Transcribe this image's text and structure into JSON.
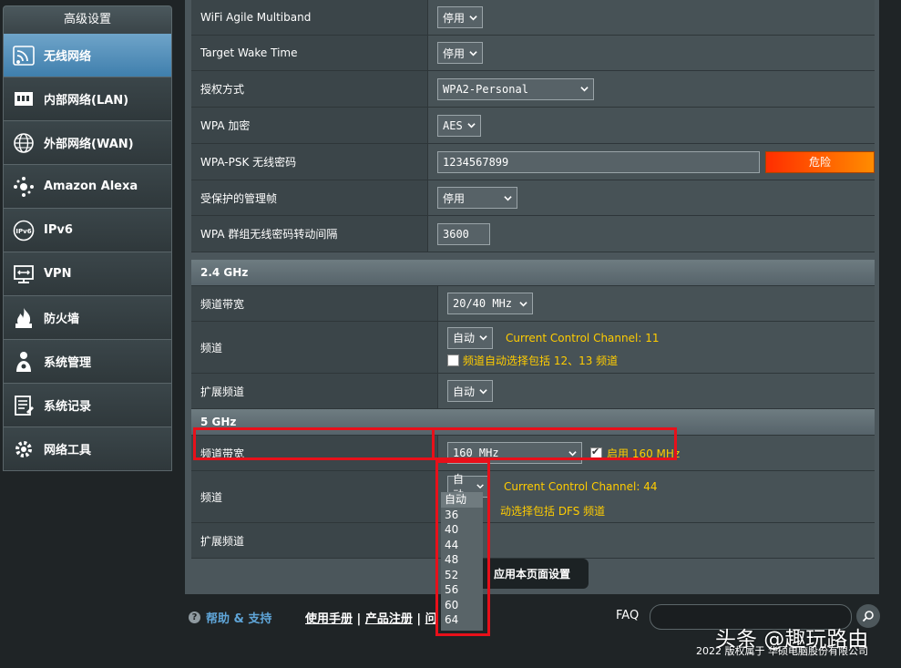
{
  "sidebar": {
    "title": "高级设置",
    "items": [
      {
        "label": "无线网络",
        "icon": "wifi-icon",
        "active": true
      },
      {
        "label": "内部网络(LAN)",
        "icon": "lan-icon"
      },
      {
        "label": "外部网络(WAN)",
        "icon": "globe-icon"
      },
      {
        "label": "Amazon Alexa",
        "icon": "alexa-icon"
      },
      {
        "label": "IPv6",
        "icon": "ipv6-icon"
      },
      {
        "label": "VPN",
        "icon": "vpn-icon"
      },
      {
        "label": "防火墙",
        "icon": "firewall-icon"
      },
      {
        "label": "系统管理",
        "icon": "admin-icon"
      },
      {
        "label": "系统记录",
        "icon": "log-icon"
      },
      {
        "label": "网络工具",
        "icon": "tools-icon"
      }
    ]
  },
  "rows": {
    "agile": {
      "label": "WiFi Agile Multiband",
      "value": "停用"
    },
    "twt": {
      "label": "Target Wake Time",
      "value": "停用"
    },
    "auth": {
      "label": "授权方式",
      "value": "WPA2-Personal"
    },
    "wpa_enc": {
      "label": "WPA 加密",
      "value": "AES"
    },
    "psk": {
      "label": "WPA-PSK 无线密码",
      "value": "1234567899",
      "strength": "危险"
    },
    "pmf": {
      "label": "受保护的管理帧",
      "value": "停用"
    },
    "rekey": {
      "label": "WPA 群组无线密码转动间隔",
      "value": "3600"
    }
  },
  "band24": {
    "title": "2.4 GHz",
    "bandwidth_label": "频道带宽",
    "bandwidth_value": "20/40 MHz",
    "channel_label": "频道",
    "channel_value": "自动",
    "current_channel": "Current Control Channel: 11",
    "auto_include": "频道自动选择包括 12、13 频道",
    "ext_label": "扩展频道",
    "ext_value": "自动"
  },
  "band5": {
    "title": "5 GHz",
    "bandwidth_label": "频道带宽",
    "bandwidth_value": "160 MHz",
    "enable_160": "启用 160 MHz",
    "channel_label": "频道",
    "channel_value": "自动",
    "current_channel": "Current Control Channel: 44",
    "auto_include": "动选择包括 DFS 频道",
    "ext_label": "扩展频道",
    "options": [
      "自动",
      "36",
      "40",
      "44",
      "48",
      "52",
      "56",
      "60",
      "64"
    ]
  },
  "apply_label": "应用本页面设置",
  "footer": {
    "help": "帮助 & 支持",
    "manual": "使用手册",
    "register": "产品注册",
    "sep": " | ",
    "partial": "问",
    "faq": "FAQ",
    "copyright": "2022 版权属于 华硕电脑股份有限公司",
    "watermark": "头条 @趣玩路由"
  }
}
